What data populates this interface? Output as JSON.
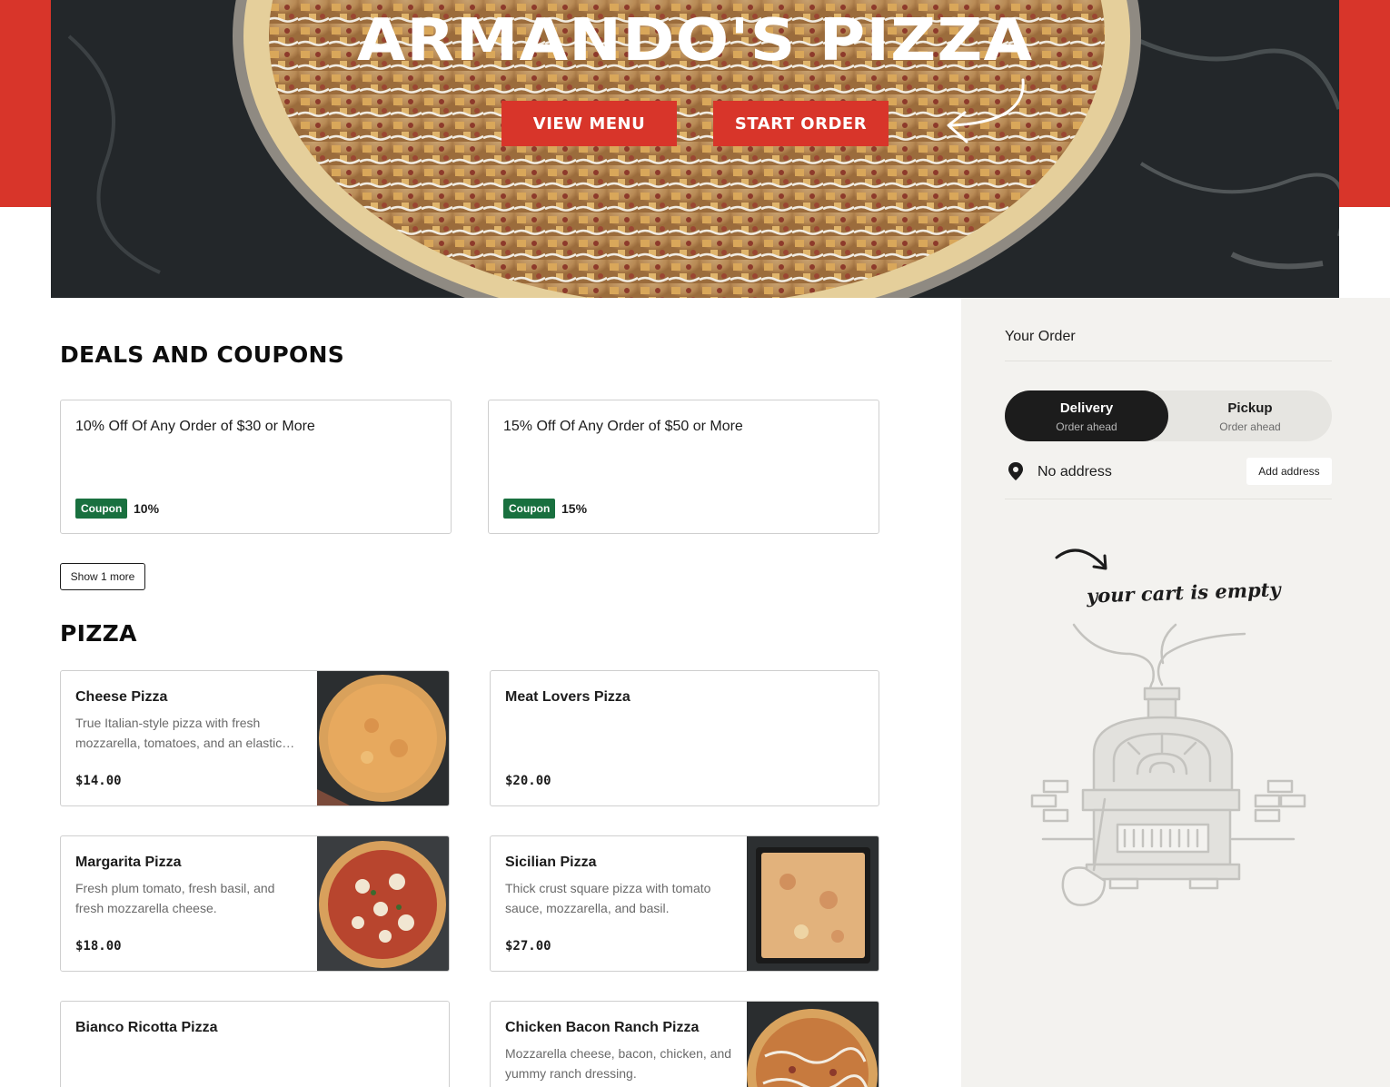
{
  "hero": {
    "title": "ARMANDO'S PIZZA",
    "view_menu_label": "VIEW MENU",
    "start_order_label": "START ORDER",
    "accent_color": "#d8352a"
  },
  "deals": {
    "title": "DEALS AND COUPONS",
    "coupons": [
      {
        "title": "10% Off Of Any Order of $30 or More",
        "badge": "Coupon",
        "value": "10%"
      },
      {
        "title": "15% Off Of Any Order of $50 or More",
        "badge": "Coupon",
        "value": "15%"
      }
    ],
    "show_more_label": "Show 1 more",
    "badge_color": "#19703f"
  },
  "pizza": {
    "title": "PIZZA",
    "items": [
      {
        "name": "Cheese Pizza",
        "description": "True Italian-style pizza with fresh mozzarella, tomatoes, and an elastic crust.",
        "price": "$14.00"
      },
      {
        "name": "Meat Lovers Pizza",
        "description": "",
        "price": "$20.00"
      },
      {
        "name": "Margarita Pizza",
        "description": "Fresh plum tomato, fresh basil, and fresh mozzarella cheese.",
        "price": "$18.00"
      },
      {
        "name": "Sicilian Pizza",
        "description": "Thick crust square pizza with tomato sauce, mozzarella, and basil.",
        "price": "$27.00"
      },
      {
        "name": "Bianco Ricotta Pizza",
        "description": "",
        "price": ""
      },
      {
        "name": "Chicken Bacon Ranch Pizza",
        "description": "Mozzarella cheese, bacon, chicken, and yummy ranch dressing.",
        "price": ""
      }
    ]
  },
  "order": {
    "title": "Your Order",
    "delivery_label": "Delivery",
    "delivery_sub": "Order ahead",
    "pickup_label": "Pickup",
    "pickup_sub": "Order ahead",
    "selected_mode": "Delivery",
    "address_text": "No address",
    "add_address_label": "Add address",
    "empty_cart_text": "your cart is empty"
  },
  "icons": {
    "hero_arrow": "curved-arrow-icon",
    "location": "map-pin-icon",
    "cart_arrow": "curved-arrow-icon",
    "illustration": "pizza-oven-illustration"
  }
}
